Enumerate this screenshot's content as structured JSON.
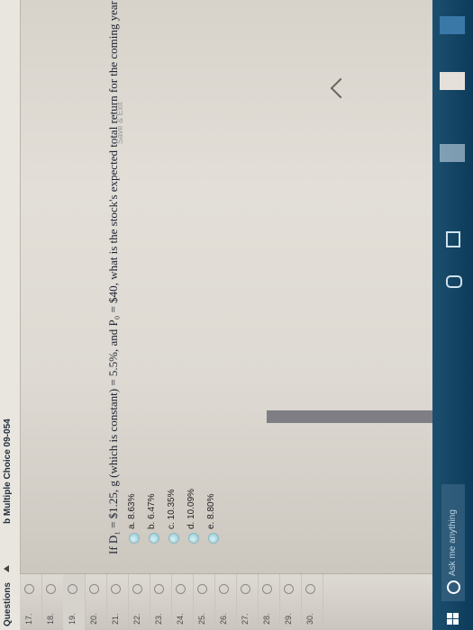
{
  "tabs": {
    "questions": "Questions",
    "question_type": "b Multiple Choice 09-054"
  },
  "question_nav": [
    {
      "num": "17."
    },
    {
      "num": "18."
    },
    {
      "num": "19."
    },
    {
      "num": "20."
    },
    {
      "num": "21."
    },
    {
      "num": "22."
    },
    {
      "num": "23."
    },
    {
      "num": "24."
    },
    {
      "num": "25."
    },
    {
      "num": "26."
    },
    {
      "num": "27."
    },
    {
      "num": "28."
    },
    {
      "num": "29."
    },
    {
      "num": "30."
    }
  ],
  "question": {
    "text": "If D₁ = $1.25, g (which is constant) = 5.5%, and P₀ = $40, what is the stock's expected total return for the coming year"
  },
  "options": [
    {
      "label": "a. 8.63%"
    },
    {
      "label": "b. 6.47%"
    },
    {
      "label": "c. 10.35%"
    },
    {
      "label": "d. 10.09%"
    },
    {
      "label": "e. 8.80%"
    }
  ],
  "footer": {
    "faint_text": "Save & Exit"
  },
  "taskbar": {
    "search_placeholder": "Ask me anything"
  },
  "colors": {
    "taskbar": "#0d3b5a",
    "radio": "#9fd2dc",
    "text": "#1d2330"
  }
}
